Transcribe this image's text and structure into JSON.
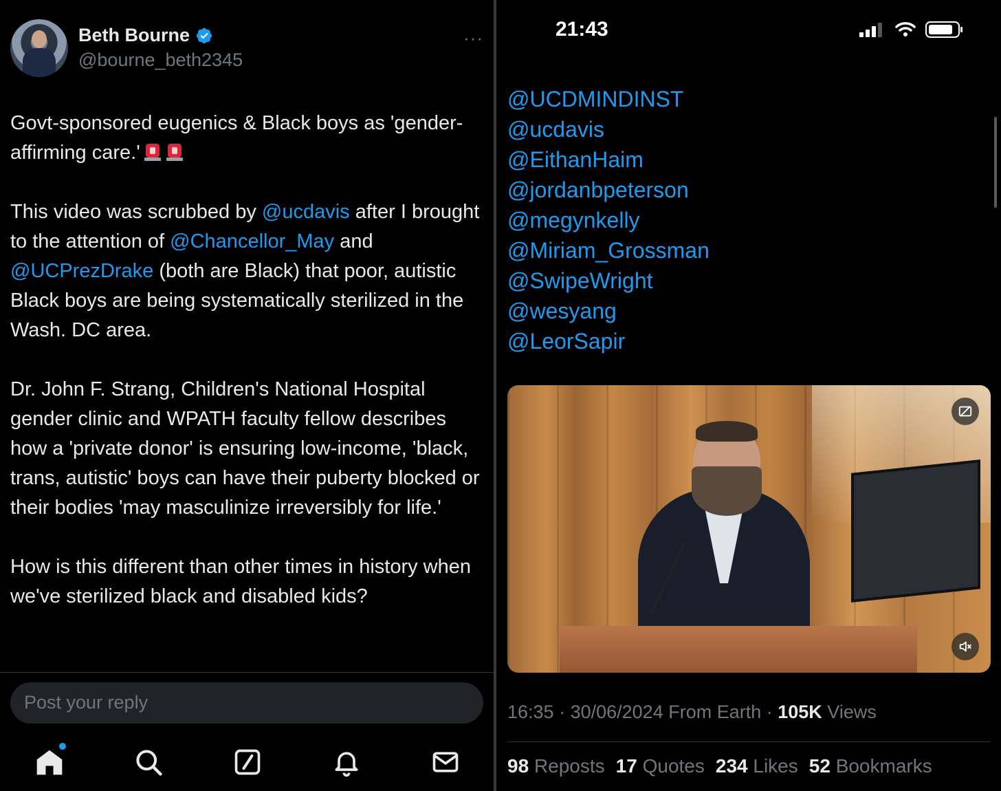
{
  "post": {
    "author_name": "Beth Bourne",
    "author_handle": "@bourne_beth2345",
    "more_label": "···",
    "p1_text": "Govt-sponsored eugenics & Black boys as 'gender-affirming care.'",
    "p2_a": "This video was scrubbed by ",
    "p2_m1": "@ucdavis",
    "p2_b": " after I brought to the attention of ",
    "p2_m2": "@Chancellor_May",
    "p2_c": " and ",
    "p2_m3": "@UCPrezDrake",
    "p2_d": " (both are Black) that poor, autistic Black boys are being systematically sterilized in the Wash. DC area.",
    "p3": "Dr. John F. Strang, Children's National Hospital gender clinic and WPATH faculty fellow describes how a 'private donor' is ensuring low-income, 'black, trans, autistic' boys can have their puberty blocked or their bodies 'may masculinize irreversibly for life.'",
    "p4": "How is this different than other times in history when we've sterilized black and disabled kids?",
    "reply_placeholder": "Post your reply"
  },
  "nav": {
    "items": [
      "home-icon",
      "search-icon",
      "compose-icon",
      "notifications-icon",
      "messages-icon"
    ],
    "accent": "#1d9bf0"
  },
  "status_bar": {
    "time": "21:43"
  },
  "mentions": [
    "@UCDMINDINST",
    "@ucdavis",
    "@EithanHaim",
    "@jordanbpeterson",
    "@megynkelly",
    "@Miriam_Grossman",
    "@SwipeWright",
    "@wesyang",
    "@LeorSapir"
  ],
  "meta": {
    "time": "16:35",
    "sep1": " · ",
    "date": "30/06/2024",
    "source": " From Earth",
    "sep2": " · ",
    "views_count": "105K",
    "views_label": " Views"
  },
  "stats": {
    "reposts_count": "98",
    "reposts_label": "Reposts",
    "quotes_count": "17",
    "quotes_label": "Quotes",
    "likes_count": "234",
    "likes_label": "Likes",
    "bookmarks_count": "52",
    "bookmarks_label": "Bookmarks"
  },
  "colors": {
    "link": "#1d9bf0",
    "muted": "#71767b",
    "text": "#e7e9ea",
    "background": "#000000"
  }
}
